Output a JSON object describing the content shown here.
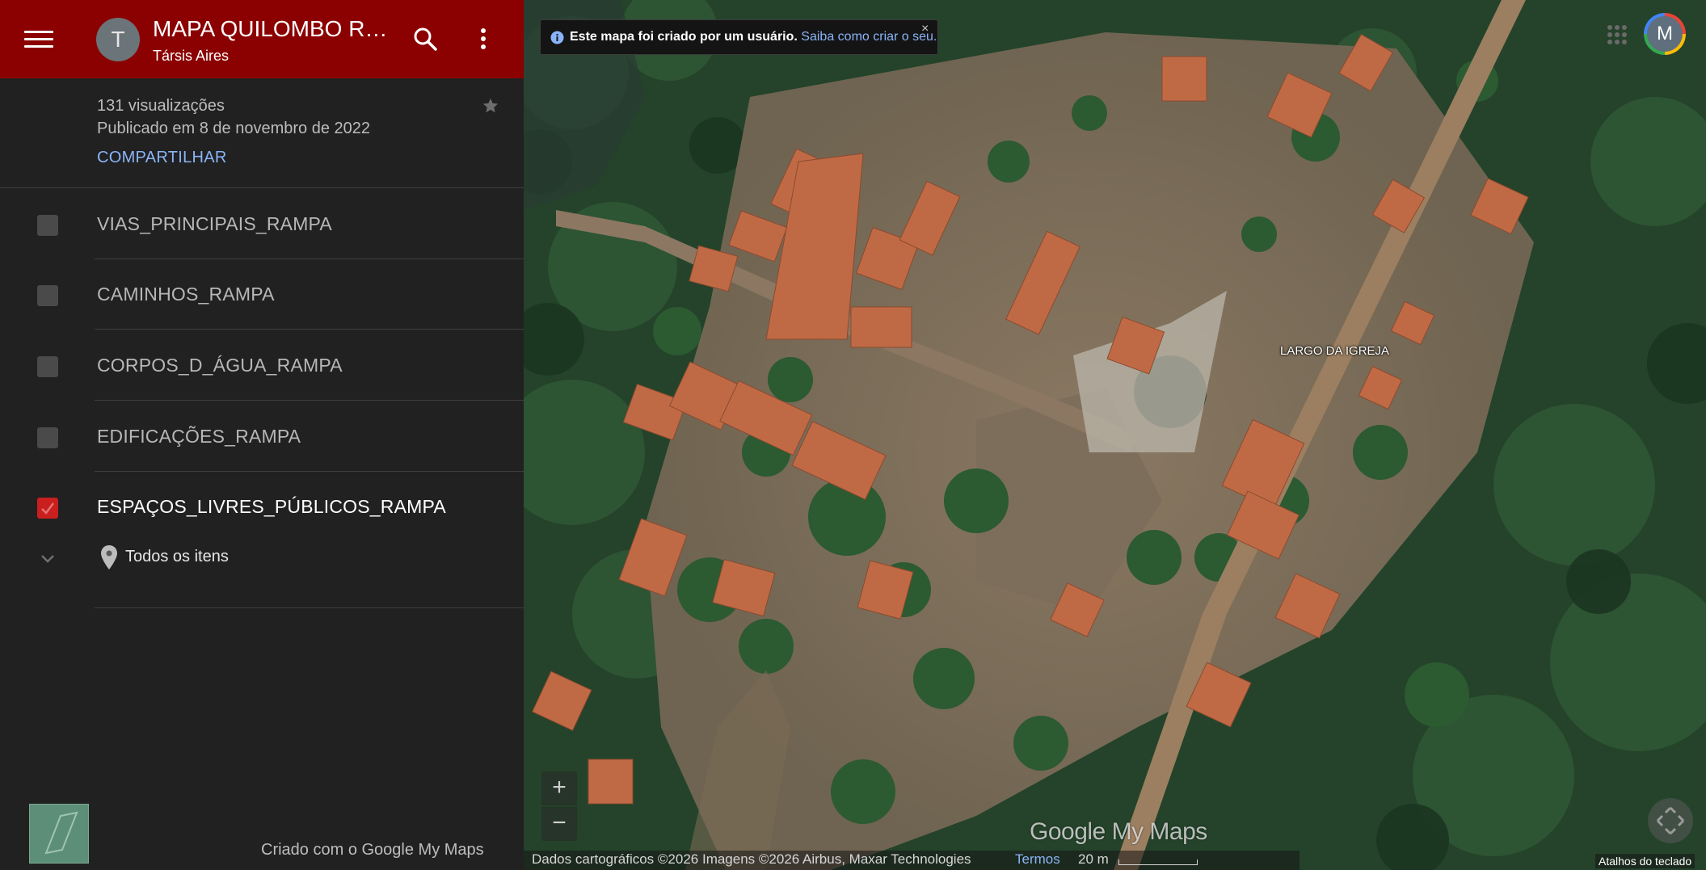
{
  "header": {
    "avatar_letter": "T",
    "title": "MAPA QUILOMBO RAMPA",
    "author": "Társis Aires"
  },
  "info": {
    "views": "131 visualizações",
    "published": "Publicado em 8 de novembro de 2022",
    "share": "COMPARTILHAR"
  },
  "layers": [
    {
      "label": "VIAS_PRINCIPAIS_RAMPA",
      "checked": false
    },
    {
      "label": "CAMINHOS_RAMPA",
      "checked": false
    },
    {
      "label": "CORPOS_D_ÁGUA_RAMPA",
      "checked": false
    },
    {
      "label": "EDIFICAÇÕES_RAMPA",
      "checked": false
    },
    {
      "label": "ESPAÇOS_LIVRES_PÚBLICOS_RAMPA",
      "checked": true
    }
  ],
  "sublayer": {
    "label": "Todos os itens"
  },
  "footer": {
    "created_with": "Criado com o Google My Maps"
  },
  "map": {
    "notice_text": "Este mapa foi criado por um usuário.",
    "notice_link": "Saiba como criar o seu.",
    "account_letter": "M",
    "place_label": "LARGO DA IGREJA",
    "zoom_in": "+",
    "zoom_out": "−",
    "logo": "Google My Maps",
    "attribution": "Dados cartográficos ©2026 Imagens ©2026 Airbus, Maxar Technologies",
    "terms": "Termos",
    "scale": "20 m",
    "shortcuts": "Atalhos do teclado"
  },
  "colors": {
    "header_bg": "#8b0000",
    "sidebar_bg": "#212121",
    "link": "#8ab4f8",
    "checkbox_checked": "#c91f1f"
  }
}
